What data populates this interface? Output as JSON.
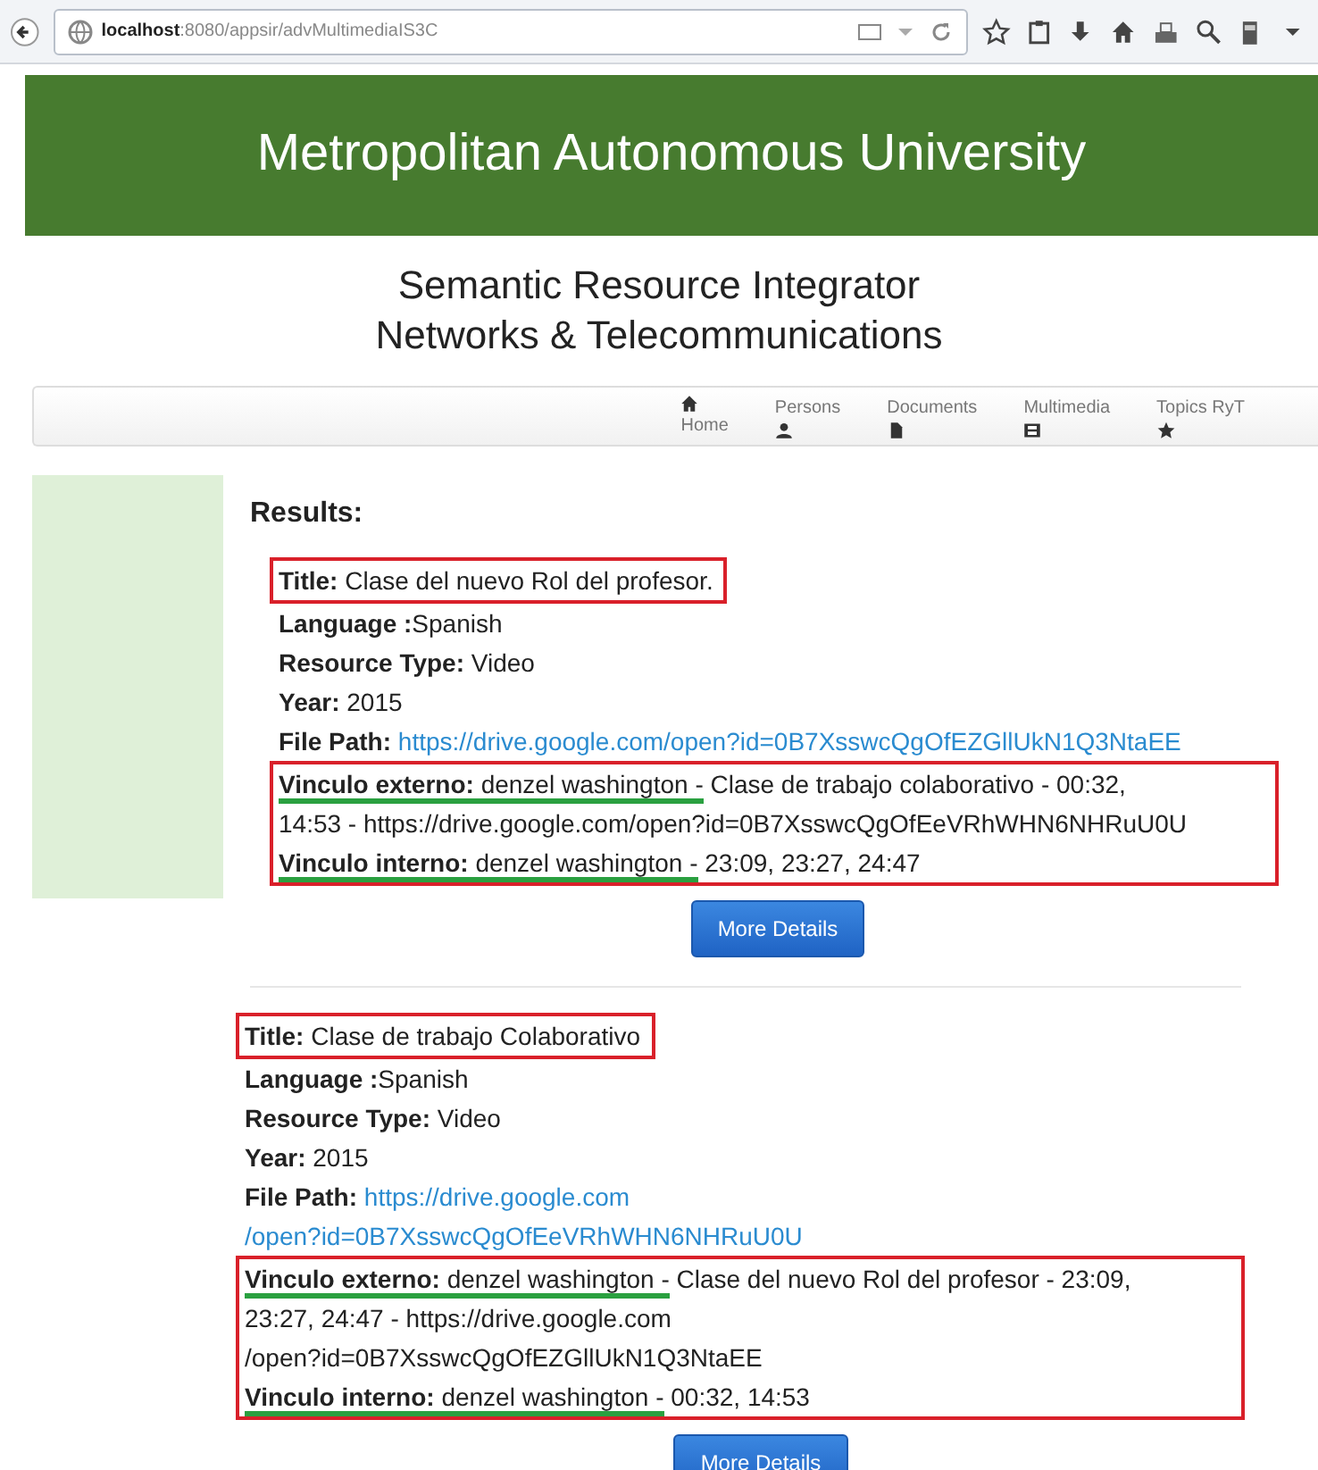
{
  "browser": {
    "host": "localhost",
    "path": ":8080/appsir/advMultimediaIS3C"
  },
  "header": {
    "title": "Metropolitan Autonomous University"
  },
  "subtitle": [
    "Semantic Resource Integrator",
    "Networks & Telecommunications"
  ],
  "nav": [
    {
      "label": "Home"
    },
    {
      "label": "Persons"
    },
    {
      "label": "Documents"
    },
    {
      "label": "Multimedia"
    },
    {
      "label": "Topics RyT"
    }
  ],
  "results_heading": "Results:",
  "results": [
    {
      "title": {
        "label": "Title:",
        "value": "Clase del nuevo Rol del profesor.",
        "highlighted": true
      },
      "details": [
        {
          "label": "Language :",
          "value": "Spanish"
        },
        {
          "label": "Resource Type:",
          "value": "Video"
        },
        {
          "label": "Year:",
          "value": "2015"
        }
      ],
      "file_path": {
        "label": "File Path:",
        "lines": [
          "https://drive.google.com/open?id=0B7XsswcQgOfEZGllUkN1Q3NtaEE"
        ]
      },
      "links": {
        "highlighted": true,
        "items": [
          {
            "label": "Vinculo externo:",
            "person": "denzel washington -",
            "underlined": true,
            "lines": [
              "Clase de trabajo colaborativo - 00:32,",
              "14:53 - https://drive.google.com/open?id=0B7XsswcQgOfEeVRhWHN6NHRuU0U"
            ]
          },
          {
            "label": "Vinculo interno:",
            "person": "denzel washington -",
            "underlined": true,
            "lines": [
              "23:09, 23:27, 24:47"
            ]
          }
        ]
      },
      "button": "More Details"
    },
    {
      "title": {
        "label": "Title:",
        "value": "Clase de trabajo Colaborativo",
        "highlighted": true
      },
      "details": [
        {
          "label": "Language :",
          "value": "Spanish"
        },
        {
          "label": "Resource Type:",
          "value": "Video"
        },
        {
          "label": "Year:",
          "value": "2015"
        }
      ],
      "file_path": {
        "label": "File Path:",
        "lines": [
          "https://drive.google.com",
          "/open?id=0B7XsswcQgOfEeVRhWHN6NHRuU0U"
        ]
      },
      "links": {
        "highlighted": true,
        "items": [
          {
            "label": "Vinculo externo:",
            "person": "denzel washington -",
            "underlined": true,
            "lines": [
              "Clase del nuevo Rol del profesor - 23:09,",
              "23:27, 24:47 - https://drive.google.com",
              "/open?id=0B7XsswcQgOfEZGllUkN1Q3NtaEE"
            ]
          },
          {
            "label": "Vinculo interno:",
            "person": "denzel washington -",
            "underlined": true,
            "lines": [
              "00:32, 14:53"
            ]
          }
        ]
      },
      "button": "More Details"
    }
  ]
}
